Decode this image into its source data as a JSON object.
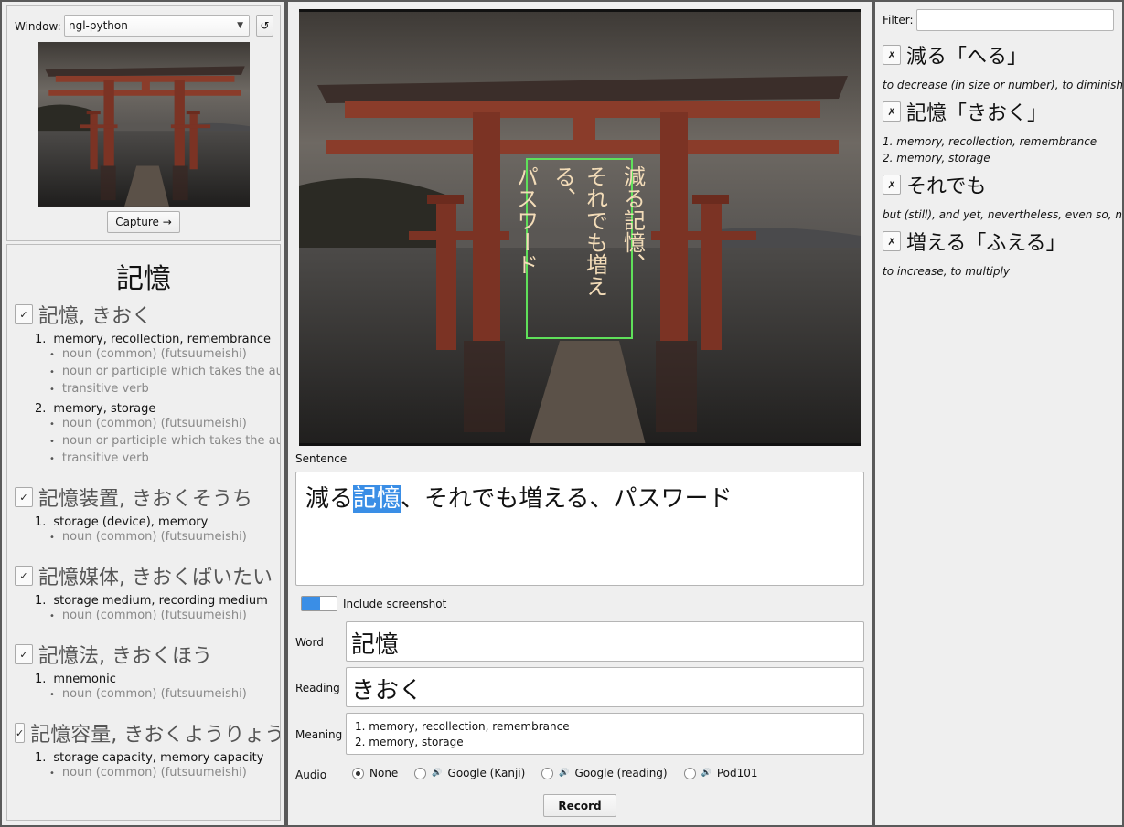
{
  "capture": {
    "window_label": "Window:",
    "window_value": "ngl-python",
    "refresh_icon": "refresh-icon",
    "capture_label": "Capture →"
  },
  "overlay_text": [
    "減る記憶、",
    "それでも増える、",
    "パスワード"
  ],
  "lookup": {
    "headword": "記憶",
    "entries": [
      {
        "term": "記憶",
        "reading": ", きおく",
        "senses": [
          {
            "n": "1.",
            "gloss": "memory, recollection, remembrance",
            "tags": [
              "noun (common) (futsuumeishi)",
              "noun or participle which takes the aux",
              "transitive verb"
            ]
          },
          {
            "n": "2.",
            "gloss": "memory, storage",
            "tags": [
              "noun (common) (futsuumeishi)",
              "noun or participle which takes the aux",
              "transitive verb"
            ]
          }
        ]
      },
      {
        "term": "記憶装置",
        "reading": ", きおくそうち",
        "senses": [
          {
            "n": "1.",
            "gloss": "storage (device), memory",
            "tags": [
              "noun (common) (futsuumeishi)"
            ]
          }
        ]
      },
      {
        "term": "記憶媒体",
        "reading": ", きおくばいたい",
        "senses": [
          {
            "n": "1.",
            "gloss": "storage medium, recording medium",
            "tags": [
              "noun (common) (futsuumeishi)"
            ]
          }
        ]
      },
      {
        "term": "記憶法",
        "reading": ", きおくほう",
        "senses": [
          {
            "n": "1.",
            "gloss": "mnemonic",
            "tags": [
              "noun (common) (futsuumeishi)"
            ]
          }
        ]
      },
      {
        "term": "記憶容量",
        "reading": ", きおくようりょう",
        "senses": [
          {
            "n": "1.",
            "gloss": "storage capacity, memory capacity",
            "tags": [
              "noun (common) (futsuumeishi)"
            ]
          }
        ]
      }
    ]
  },
  "sentence": {
    "label": "Sentence",
    "before": "減る",
    "selected": "記憶",
    "after": "、それでも増える、パスワード",
    "selection_color": "#3a8ee6"
  },
  "form": {
    "include_screenshot_label": "Include screenshot",
    "include_screenshot": true,
    "word_label": "Word",
    "word": "記憶",
    "reading_label": "Reading",
    "reading": "きおく",
    "meaning_label": "Meaning",
    "meaning": [
      "1. memory, recollection, remembrance",
      "2. memory, storage"
    ],
    "audio_label": "Audio",
    "audio_options": [
      "None",
      "Google (Kanji)",
      "Google (reading)",
      "Pod101"
    ],
    "audio_selected": "None",
    "record_label": "Record"
  },
  "vocab": {
    "filter_label": "Filter:",
    "filter_value": "",
    "items": [
      {
        "word": "減る「へる」",
        "def": [
          "to decrease (in size or number), to diminish,"
        ]
      },
      {
        "word": "記憶「きおく」",
        "def": [
          "1. memory, recollection, remembrance",
          "2. memory, storage"
        ]
      },
      {
        "word": "それでも",
        "def": [
          "but (still), and yet, nevertheless, even so, not"
        ]
      },
      {
        "word": "増える「ふえる」",
        "def": [
          "to increase, to multiply"
        ]
      }
    ],
    "remove_symbol": "✗"
  }
}
